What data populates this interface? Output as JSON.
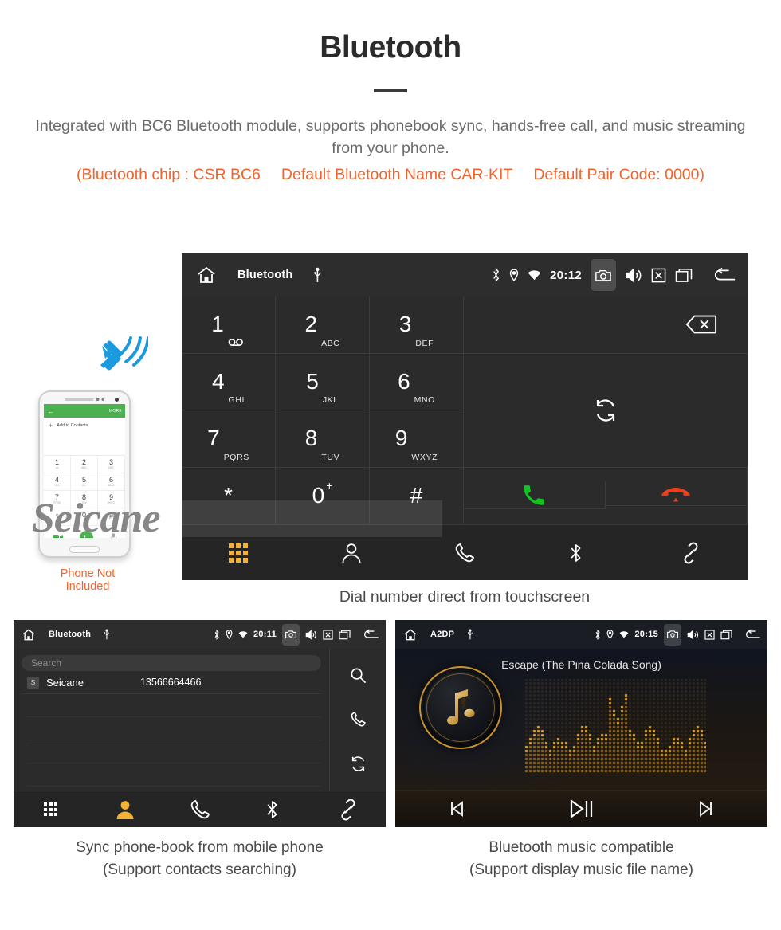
{
  "header": {
    "title": "Bluetooth",
    "intro": "Integrated with BC6 Bluetooth module, supports phonebook sync, hands-free call, and music streaming from your phone.",
    "spec_chip": "(Bluetooth chip : CSR BC6",
    "spec_name": "Default Bluetooth Name CAR-KIT",
    "spec_pair": "Default Pair Code: 0000)",
    "accent_color": "#f4622b",
    "title_color": "#2b2b2b",
    "body_color": "#6b6b6b"
  },
  "dialer": {
    "statusbar": {
      "home_icon": "home-icon",
      "title": "Bluetooth",
      "usb_icon": "usb-icon",
      "bluetooth_icon": "bluetooth-icon",
      "location_icon": "location-icon",
      "wifi_icon": "wifi-icon",
      "time": "20:12",
      "camera_icon": "camera-icon",
      "volume_icon": "volume-icon",
      "close_icon": "close-box-icon",
      "recents_icon": "recents-icon",
      "back_icon": "back-icon"
    },
    "keys": [
      {
        "num": "1",
        "sub": ""
      },
      {
        "num": "2",
        "sub": "ABC"
      },
      {
        "num": "3",
        "sub": "DEF"
      },
      {
        "num": "4",
        "sub": "GHI"
      },
      {
        "num": "5",
        "sub": "JKL"
      },
      {
        "num": "6",
        "sub": "MNO"
      },
      {
        "num": "7",
        "sub": "PQRS"
      },
      {
        "num": "8",
        "sub": "TUV"
      },
      {
        "num": "9",
        "sub": "WXYZ"
      },
      {
        "num": "*",
        "sub": ""
      },
      {
        "num": "0",
        "sub": "+"
      },
      {
        "num": "#",
        "sub": ""
      }
    ],
    "number_display": "",
    "backspace_icon": "backspace-icon",
    "sync_icon": "sync-icon",
    "call_icon": "call-green-icon",
    "hangup_icon": "hangup-red-icon",
    "nav": [
      {
        "name": "keypad",
        "icon": "keypad-icon",
        "active": true
      },
      {
        "name": "contacts",
        "icon": "contact-icon",
        "active": false
      },
      {
        "name": "call-log",
        "icon": "handset-icon",
        "active": false
      },
      {
        "name": "bluetooth",
        "icon": "bluetooth-icon",
        "active": false
      },
      {
        "name": "link",
        "icon": "link-icon",
        "active": false
      }
    ],
    "active_color": "#f2b232",
    "caption": "Dial number direct from touchscreen"
  },
  "phone_mockup": {
    "topbar_back": "←",
    "topbar_more": "MORE",
    "add_plus": "+",
    "add_label": "Add to Contacts",
    "keys": [
      {
        "num": "1",
        "sub": "oo"
      },
      {
        "num": "2",
        "sub": "ABC"
      },
      {
        "num": "3",
        "sub": "DEF"
      },
      {
        "num": "4",
        "sub": "GHI"
      },
      {
        "num": "5",
        "sub": "JKL"
      },
      {
        "num": "6",
        "sub": "MNO"
      },
      {
        "num": "7",
        "sub": "PQRS"
      },
      {
        "num": "8",
        "sub": "TUV"
      },
      {
        "num": "9",
        "sub": "WXYZ"
      },
      {
        "num": "*",
        "sub": ""
      },
      {
        "num": "0",
        "sub": "+"
      },
      {
        "num": "#",
        "sub": ""
      }
    ],
    "note": "Phone Not Included",
    "note_color": "#f4622b",
    "bluetooth_wave_icon": "bluetooth-signal-icon",
    "bluetooth_color": "#1b9ae0"
  },
  "phonebook": {
    "statusbar": {
      "title": "Bluetooth",
      "time": "20:11"
    },
    "search_placeholder": "Search",
    "search_value": "",
    "contacts": [
      {
        "badge": "S",
        "name": "Seicane",
        "number": "13566664466"
      }
    ],
    "empty_rows": 4,
    "rail": [
      {
        "name": "search",
        "icon": "search-icon"
      },
      {
        "name": "call",
        "icon": "handset-icon"
      },
      {
        "name": "sync",
        "icon": "sync-icon"
      }
    ],
    "nav": [
      {
        "name": "keypad",
        "icon": "keypad-icon",
        "active": false
      },
      {
        "name": "contacts",
        "icon": "contact-icon",
        "active": true
      },
      {
        "name": "call-log",
        "icon": "handset-icon",
        "active": false
      },
      {
        "name": "bluetooth",
        "icon": "bluetooth-icon",
        "active": false
      },
      {
        "name": "link",
        "icon": "link-icon",
        "active": false
      }
    ],
    "caption_line1": "Sync phone-book from mobile phone",
    "caption_line2": "(Support contacts searching)"
  },
  "music": {
    "statusbar": {
      "title": "A2DP",
      "time": "20:15"
    },
    "track_title": "Escape (The Pina Colada Song)",
    "album_icon": "music-note-bluetooth-icon",
    "accent_color": "#c8922f",
    "controls": [
      {
        "name": "previous",
        "icon": "skip-previous-icon"
      },
      {
        "name": "play-pause",
        "icon": "play-pause-icon"
      },
      {
        "name": "next",
        "icon": "skip-next-icon"
      }
    ],
    "caption_line1": "Bluetooth music compatible",
    "caption_line2": "(Support display music file name)"
  },
  "watermark": {
    "text": "Seicane"
  }
}
